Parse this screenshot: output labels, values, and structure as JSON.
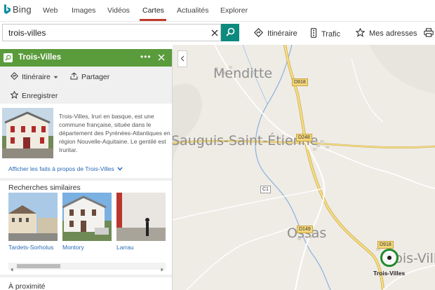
{
  "brand": {
    "name": "Bing"
  },
  "nav": {
    "items": [
      {
        "label": "Web"
      },
      {
        "label": "Images"
      },
      {
        "label": "Vidéos"
      },
      {
        "label": "Cartes"
      },
      {
        "label": "Actualités"
      },
      {
        "label": "Explorer"
      }
    ],
    "active": "Cartes",
    "accent": "#c0392b"
  },
  "search": {
    "value": "trois-villes",
    "button_color": "#0d8a7e",
    "icons": {
      "clear": "close-icon",
      "submit": "search-icon"
    }
  },
  "toolbar": {
    "itinerary": "Itinéraire",
    "traffic": "Trafic",
    "my_addresses": "Mes adresses"
  },
  "panel": {
    "title": "Trois-Villes",
    "header_color": "#5a9b3c",
    "actions": {
      "itinerary": "Itinéraire",
      "share": "Partager",
      "save": "Enregistrer"
    },
    "description": "Trois-Villes, Iruri en basque, est une commune française, située dans le département des Pyrénées-Atlantiques en région Nouvelle-Aquitaine. Le gentilé est Iruritar.",
    "facts_link": "Afficher les faits à propos de Trois-Villes",
    "similar": {
      "title": "Recherches similaires",
      "items": [
        {
          "label": "Tardets-Sorholus"
        },
        {
          "label": "Montory"
        },
        {
          "label": "Larrau"
        }
      ]
    },
    "nearby_title": "À proximité"
  },
  "map": {
    "towns": [
      "Menditte",
      "Sauguis-Saint-Étienne",
      "Ossas",
      "Trois-Villes"
    ],
    "roads": [
      "D918",
      "D248",
      "C1",
      "D149",
      "D918"
    ],
    "pin_label": "Trois-Villes",
    "pin_color": "#1f8a2d"
  }
}
